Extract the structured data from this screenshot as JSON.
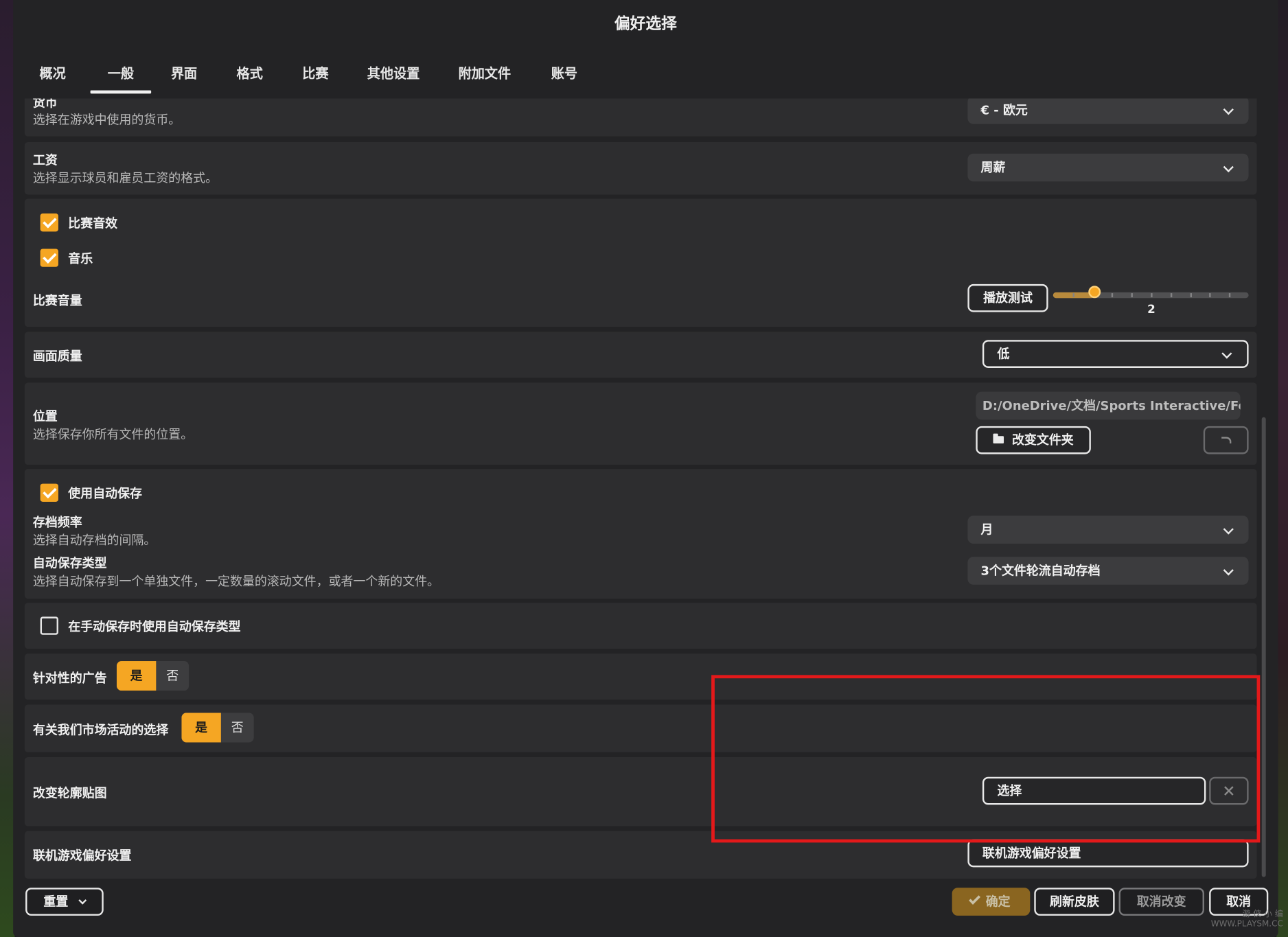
{
  "dialog": {
    "title": "偏好选择"
  },
  "tabs": [
    {
      "label": "概况"
    },
    {
      "label": "一般"
    },
    {
      "label": "界面"
    },
    {
      "label": "格式"
    },
    {
      "label": "比赛"
    },
    {
      "label": "其他设置"
    },
    {
      "label": "附加文件"
    },
    {
      "label": "账号"
    }
  ],
  "currency": {
    "label": "货币",
    "desc": "选择在游戏中使用的货币。",
    "value": "€ - 欧元"
  },
  "wage": {
    "label": "工资",
    "desc": "选择显示球员和雇员工资的格式。",
    "value": "周薪"
  },
  "audio": {
    "match_sfx_label": "比赛音效",
    "match_sfx_checked": true,
    "music_label": "音乐",
    "music_checked": true,
    "volume_label": "比赛音量",
    "test_button": "播放测试",
    "volume_value": 2,
    "volume_max": 10,
    "volume_display": "2"
  },
  "quality": {
    "label": "画面质量",
    "value": "低"
  },
  "location": {
    "label": "位置",
    "desc": "选择保存你所有文件的位置。",
    "path": "D:/OneDrive/文档/Sports Interactive/Foot...",
    "change_folder": "改变文件夹"
  },
  "autosave": {
    "enable_label": "使用自动保存",
    "enable_checked": true,
    "frequency_label": "存档频率",
    "frequency_desc": "选择自动存档的间隔。",
    "frequency_value": "月",
    "type_label": "自动保存类型",
    "type_desc": "选择自动保存到一个单独文件，一定数量的滚动文件，或者一个新的文件。",
    "type_value": "3个文件轮流自动存档"
  },
  "manual_save": {
    "label": "在手动保存时使用自动保存类型",
    "checked": false
  },
  "ads": {
    "label": "针对性的广告",
    "yes": "是",
    "no": "否",
    "selected": "是"
  },
  "marketing": {
    "label": "有关我们市场活动的选择",
    "yes": "是",
    "no": "否",
    "selected": "是"
  },
  "silhouette": {
    "label": "改变轮廓贴图",
    "button": "选择"
  },
  "online": {
    "label": "联机游戏偏好设置",
    "button": "联机游戏偏好设置"
  },
  "footer": {
    "reset": "重置",
    "confirm": "确定",
    "refresh_skin": "刷新皮肤",
    "cancel_changes": "取消改变",
    "cancel": "取消"
  },
  "watermark": {
    "line1": "游 侠 小 编",
    "line2": "WWW.PLAYSM.CC"
  },
  "colors": {
    "accent": "#f5a623",
    "highlight": "#e3191a",
    "panel": "#2d2d2f",
    "background": "#232325"
  }
}
